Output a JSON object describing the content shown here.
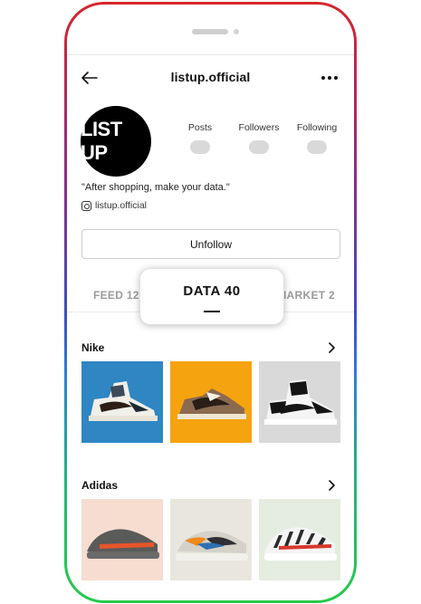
{
  "header": {
    "title": "listup.official"
  },
  "profile": {
    "avatar_text": "LIST UP",
    "stats": [
      {
        "label": "Posts"
      },
      {
        "label": "Followers"
      },
      {
        "label": "Following"
      }
    ],
    "bio": "\"After shopping, make your data.\"",
    "handle": "listup.official",
    "button_label": "Unfollow"
  },
  "tabs": {
    "feed": "FEED 12",
    "market": "MARKET 2"
  },
  "popup": {
    "text": "DATA 40"
  },
  "sections": [
    {
      "title": "Nike",
      "tile_colors": [
        "#2f86c3",
        "#f5a30f",
        "#d9d9d9"
      ]
    },
    {
      "title": "Adidas",
      "tile_colors": [
        "#f6ddd0",
        "#e9e7dd",
        "#e4ede0"
      ]
    }
  ],
  "colors": {
    "frame_top": "#d7262b",
    "frame_bottom": "#27c84a"
  }
}
